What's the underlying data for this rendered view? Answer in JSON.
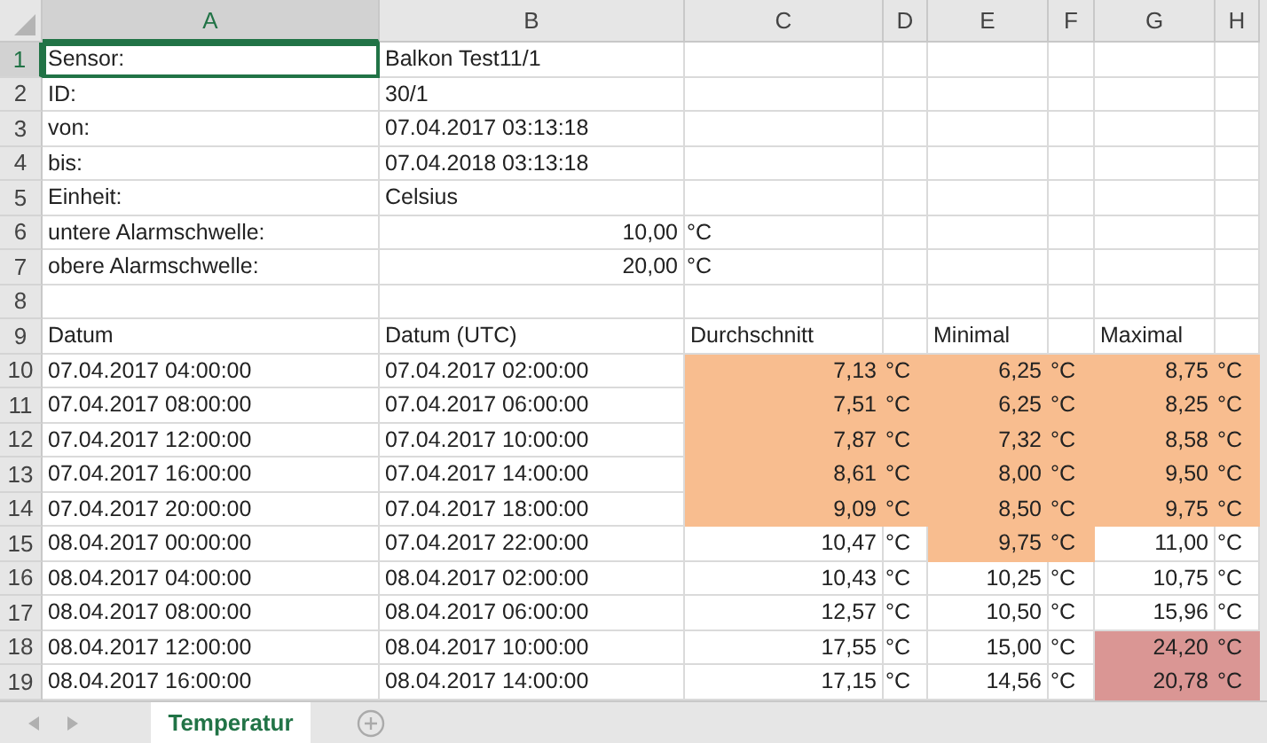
{
  "columns": [
    {
      "label": "A",
      "selected": true
    },
    {
      "label": "B",
      "selected": false
    },
    {
      "label": "C",
      "selected": false
    },
    {
      "label": "D",
      "selected": false
    },
    {
      "label": "E",
      "selected": false
    },
    {
      "label": "F",
      "selected": false
    },
    {
      "label": "G",
      "selected": false
    },
    {
      "label": "H",
      "selected": false
    }
  ],
  "rows": [
    {
      "number": "1",
      "selected": true,
      "cells": [
        {
          "kind": "text",
          "text": "Sensor:"
        },
        {
          "kind": "text",
          "text": "Balkon Test11/1"
        },
        {},
        {},
        {},
        {},
        {},
        {}
      ]
    },
    {
      "number": "2",
      "selected": false,
      "cells": [
        {
          "kind": "text",
          "text": "ID:"
        },
        {
          "kind": "text",
          "text": "30/1"
        },
        {},
        {},
        {},
        {},
        {},
        {}
      ]
    },
    {
      "number": "3",
      "selected": false,
      "cells": [
        {
          "kind": "text",
          "text": "von:"
        },
        {
          "kind": "text",
          "text": "07.04.2017 03:13:18"
        },
        {},
        {},
        {},
        {},
        {},
        {}
      ]
    },
    {
      "number": "4",
      "selected": false,
      "cells": [
        {
          "kind": "text",
          "text": "bis:"
        },
        {
          "kind": "text",
          "text": "07.04.2018 03:13:18"
        },
        {},
        {},
        {},
        {},
        {},
        {}
      ]
    },
    {
      "number": "5",
      "selected": false,
      "cells": [
        {
          "kind": "text",
          "text": "Einheit:"
        },
        {
          "kind": "text",
          "text": "Celsius"
        },
        {},
        {},
        {},
        {},
        {},
        {}
      ]
    },
    {
      "number": "6",
      "selected": false,
      "cells": [
        {
          "kind": "text",
          "text": "untere Alarmschwelle:"
        },
        {
          "kind": "number",
          "text": "10,00"
        },
        {
          "kind": "unit",
          "text": "°C"
        },
        {},
        {},
        {},
        {},
        {}
      ]
    },
    {
      "number": "7",
      "selected": false,
      "cells": [
        {
          "kind": "text",
          "text": "obere Alarmschwelle:"
        },
        {
          "kind": "number",
          "text": "20,00"
        },
        {
          "kind": "unit",
          "text": "°C"
        },
        {},
        {},
        {},
        {},
        {}
      ]
    },
    {
      "number": "8",
      "selected": false,
      "cells": [
        {},
        {},
        {},
        {},
        {},
        {},
        {},
        {}
      ]
    },
    {
      "number": "9",
      "selected": false,
      "cells": [
        {
          "kind": "text",
          "text": "Datum"
        },
        {
          "kind": "text",
          "text": "Datum (UTC)"
        },
        {
          "kind": "text",
          "text": "Durchschnitt"
        },
        {},
        {
          "kind": "text",
          "text": "Minimal"
        },
        {},
        {
          "kind": "text",
          "text": "Maximal"
        },
        {}
      ]
    },
    {
      "number": "10",
      "selected": false,
      "cells": [
        {
          "kind": "text",
          "text": "07.04.2017 04:00:00"
        },
        {
          "kind": "text",
          "text": "07.04.2017 02:00:00"
        },
        {
          "kind": "number",
          "text": "7,13",
          "color": "#f8bd8f"
        },
        {
          "kind": "unit",
          "text": "°C",
          "color": "#f8bd8f"
        },
        {
          "kind": "number",
          "text": "6,25",
          "color": "#f8bd8f"
        },
        {
          "kind": "unit",
          "text": "°C",
          "color": "#f8bd8f"
        },
        {
          "kind": "number",
          "text": "8,75",
          "color": "#f8bd8f"
        },
        {
          "kind": "unit",
          "text": "°C",
          "color": "#f8bd8f"
        }
      ]
    },
    {
      "number": "11",
      "selected": false,
      "cells": [
        {
          "kind": "text",
          "text": "07.04.2017 08:00:00"
        },
        {
          "kind": "text",
          "text": "07.04.2017 06:00:00"
        },
        {
          "kind": "number",
          "text": "7,51",
          "color": "#f8bd8f"
        },
        {
          "kind": "unit",
          "text": "°C",
          "color": "#f8bd8f"
        },
        {
          "kind": "number",
          "text": "6,25",
          "color": "#f8bd8f"
        },
        {
          "kind": "unit",
          "text": "°C",
          "color": "#f8bd8f"
        },
        {
          "kind": "number",
          "text": "8,25",
          "color": "#f8bd8f"
        },
        {
          "kind": "unit",
          "text": "°C",
          "color": "#f8bd8f"
        }
      ]
    },
    {
      "number": "12",
      "selected": false,
      "cells": [
        {
          "kind": "text",
          "text": "07.04.2017 12:00:00"
        },
        {
          "kind": "text",
          "text": "07.04.2017 10:00:00"
        },
        {
          "kind": "number",
          "text": "7,87",
          "color": "#f8bd8f"
        },
        {
          "kind": "unit",
          "text": "°C",
          "color": "#f8bd8f"
        },
        {
          "kind": "number",
          "text": "7,32",
          "color": "#f8bd8f"
        },
        {
          "kind": "unit",
          "text": "°C",
          "color": "#f8bd8f"
        },
        {
          "kind": "number",
          "text": "8,58",
          "color": "#f8bd8f"
        },
        {
          "kind": "unit",
          "text": "°C",
          "color": "#f8bd8f"
        }
      ]
    },
    {
      "number": "13",
      "selected": false,
      "cells": [
        {
          "kind": "text",
          "text": "07.04.2017 16:00:00"
        },
        {
          "kind": "text",
          "text": "07.04.2017 14:00:00"
        },
        {
          "kind": "number",
          "text": "8,61",
          "color": "#f8bd8f"
        },
        {
          "kind": "unit",
          "text": "°C",
          "color": "#f8bd8f"
        },
        {
          "kind": "number",
          "text": "8,00",
          "color": "#f8bd8f"
        },
        {
          "kind": "unit",
          "text": "°C",
          "color": "#f8bd8f"
        },
        {
          "kind": "number",
          "text": "9,50",
          "color": "#f8bd8f"
        },
        {
          "kind": "unit",
          "text": "°C",
          "color": "#f8bd8f"
        }
      ]
    },
    {
      "number": "14",
      "selected": false,
      "cells": [
        {
          "kind": "text",
          "text": "07.04.2017 20:00:00"
        },
        {
          "kind": "text",
          "text": "07.04.2017 18:00:00"
        },
        {
          "kind": "number",
          "text": "9,09",
          "color": "#f8bd8f"
        },
        {
          "kind": "unit",
          "text": "°C",
          "color": "#f8bd8f"
        },
        {
          "kind": "number",
          "text": "8,50",
          "color": "#f8bd8f"
        },
        {
          "kind": "unit",
          "text": "°C",
          "color": "#f8bd8f"
        },
        {
          "kind": "number",
          "text": "9,75",
          "color": "#f8bd8f"
        },
        {
          "kind": "unit",
          "text": "°C",
          "color": "#f8bd8f"
        }
      ]
    },
    {
      "number": "15",
      "selected": false,
      "cells": [
        {
          "kind": "text",
          "text": "08.04.2017 00:00:00"
        },
        {
          "kind": "text",
          "text": "07.04.2017 22:00:00"
        },
        {
          "kind": "number",
          "text": "10,47"
        },
        {
          "kind": "unit",
          "text": "°C"
        },
        {
          "kind": "number",
          "text": "9,75",
          "color": "#f8bd8f"
        },
        {
          "kind": "unit",
          "text": "°C",
          "color": "#f8bd8f"
        },
        {
          "kind": "number",
          "text": "11,00"
        },
        {
          "kind": "unit",
          "text": "°C"
        }
      ]
    },
    {
      "number": "16",
      "selected": false,
      "cells": [
        {
          "kind": "text",
          "text": "08.04.2017 04:00:00"
        },
        {
          "kind": "text",
          "text": "08.04.2017 02:00:00"
        },
        {
          "kind": "number",
          "text": "10,43"
        },
        {
          "kind": "unit",
          "text": "°C"
        },
        {
          "kind": "number",
          "text": "10,25"
        },
        {
          "kind": "unit",
          "text": "°C"
        },
        {
          "kind": "number",
          "text": "10,75"
        },
        {
          "kind": "unit",
          "text": "°C"
        }
      ]
    },
    {
      "number": "17",
      "selected": false,
      "cells": [
        {
          "kind": "text",
          "text": "08.04.2017 08:00:00"
        },
        {
          "kind": "text",
          "text": "08.04.2017 06:00:00"
        },
        {
          "kind": "number",
          "text": "12,57"
        },
        {
          "kind": "unit",
          "text": "°C"
        },
        {
          "kind": "number",
          "text": "10,50"
        },
        {
          "kind": "unit",
          "text": "°C"
        },
        {
          "kind": "number",
          "text": "15,96"
        },
        {
          "kind": "unit",
          "text": "°C"
        }
      ]
    },
    {
      "number": "18",
      "selected": false,
      "cells": [
        {
          "kind": "text",
          "text": "08.04.2017 12:00:00"
        },
        {
          "kind": "text",
          "text": "08.04.2017 10:00:00"
        },
        {
          "kind": "number",
          "text": "17,55"
        },
        {
          "kind": "unit",
          "text": "°C"
        },
        {
          "kind": "number",
          "text": "15,00"
        },
        {
          "kind": "unit",
          "text": "°C"
        },
        {
          "kind": "number",
          "text": "24,20",
          "color": "#da9694"
        },
        {
          "kind": "unit",
          "text": "°C",
          "color": "#da9694"
        }
      ]
    },
    {
      "number": "19",
      "selected": false,
      "cells": [
        {
          "kind": "text",
          "text": "08.04.2017 16:00:00"
        },
        {
          "kind": "text",
          "text": "08.04.2017 14:00:00"
        },
        {
          "kind": "number",
          "text": "17,15"
        },
        {
          "kind": "unit",
          "text": "°C"
        },
        {
          "kind": "number",
          "text": "14,56"
        },
        {
          "kind": "unit",
          "text": "°C"
        },
        {
          "kind": "number",
          "text": "20,78",
          "color": "#da9694"
        },
        {
          "kind": "unit",
          "text": "°C",
          "color": "#da9694"
        }
      ]
    }
  ],
  "sheet_tabs": [
    {
      "label": "Temperatur",
      "selected": true
    }
  ]
}
